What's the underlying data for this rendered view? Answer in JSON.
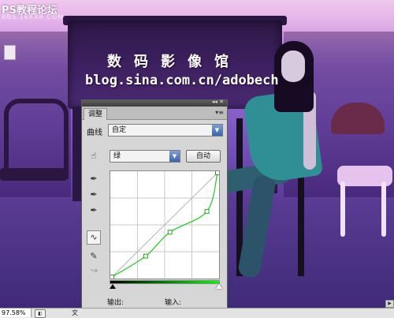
{
  "watermark": {
    "title": "PS教程论坛",
    "subtitle": "BBS.16XX8.COM"
  },
  "photo": {
    "logo_text": "数码影像馆",
    "blog_url": "blog.sina.com.cn/adobech"
  },
  "panel": {
    "tab_label": "调整",
    "curve_label": "曲线",
    "preset_value": "自定",
    "channel_value": "绿",
    "auto_button": "自动",
    "output_label": "输出:",
    "input_label": "输入:",
    "curve_color": "#2ecc2e",
    "curve_points": [
      [
        0,
        0
      ],
      [
        0.32,
        0.2
      ],
      [
        0.55,
        0.43
      ],
      [
        0.9,
        0.63
      ],
      [
        1,
        1
      ]
    ]
  },
  "statusbar": {
    "zoom": "97.58%",
    "doc_text": "文"
  },
  "icons": {
    "panel_collapse": "double-arrow-icon",
    "panel_menu": "panel-menu-icon",
    "hand_tool": "hand-adjust-icon",
    "black_eyedropper": "black-point-eyedropper-icon",
    "gray_eyedropper": "gray-point-eyedropper-icon",
    "white_eyedropper": "white-point-eyedropper-icon",
    "curve_tool": "curve-tool-icon",
    "pencil_tool": "pencil-icon",
    "smooth_tool": "smooth-icon"
  }
}
